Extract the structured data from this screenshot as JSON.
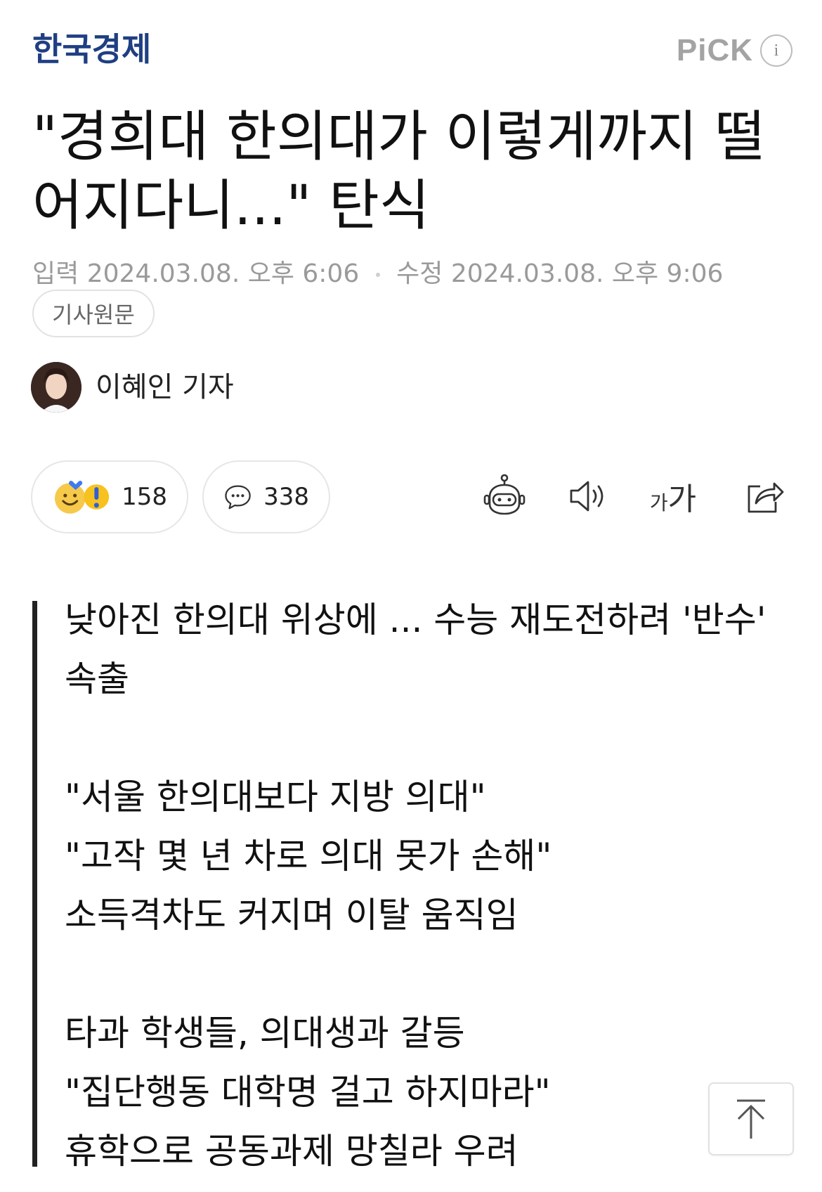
{
  "header": {
    "brand": "한국경제",
    "pick_label": "PiCK",
    "info_icon": "info-icon"
  },
  "article": {
    "headline": "\"경희대 한의대가 이렇게까지 떨어지다니...\" 탄식",
    "published_label": "입력",
    "published": "2024.03.08. 오후 6:06",
    "modified_label": "수정",
    "modified": "2024.03.08. 오후 9:06",
    "original_button": "기사원문",
    "reporter": "이혜인 기자"
  },
  "actions": {
    "reaction_count": "158",
    "comment_count": "338",
    "icons": [
      "reaction-emoji-icon",
      "comment-icon",
      "summary-bot-icon",
      "speaker-icon",
      "font-size-icon",
      "share-icon"
    ]
  },
  "summary": {
    "lines": [
      "낮아진 한의대 위상에 ... 수능 재도전하려 '반수'",
      "속출",
      "",
      "\"서울 한의대보다 지방 의대\"",
      "\"고작 몇 년 차로 의대 못가 손해\"",
      "소득격차도 커지며 이탈 움직임",
      "",
      "타과 학생들, 의대생과 갈등",
      "\"집단행동 대학명 걸고 하지마라\"",
      "휴학으로 공동과제 망칠라 우려"
    ]
  },
  "font_icon_text": {
    "small": "가",
    "large": "가"
  },
  "colors": {
    "brand": "#1f3f82",
    "muted": "#9a9a9a",
    "border": "#e6e6e6",
    "text": "#111111"
  }
}
